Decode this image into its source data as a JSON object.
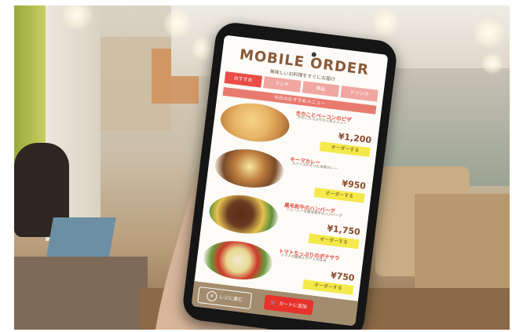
{
  "photo": {
    "subject": "hand holding smartphone with mobile order app in restaurant"
  },
  "app": {
    "title": "MOBILE ORDER",
    "subtitle": "美味しいお料理をすぐにお届け",
    "tabs": [
      {
        "label": "おすすめ",
        "active": true
      },
      {
        "label": "ランチ",
        "active": false
      },
      {
        "label": "単品",
        "active": false
      },
      {
        "label": "ドリンク",
        "active": false
      }
    ],
    "section_label": "今日のおすすめメニュー",
    "items": [
      {
        "name": "きのことベーコンのピザ",
        "description": "きのこたっぷりの人気メニュー",
        "price": "¥1,200",
        "order_label": "オーダーする"
      },
      {
        "name": "キーマカレー",
        "description": "スパイスのきいた本格カレー",
        "price": "¥950",
        "order_label": "オーダーする"
      },
      {
        "name": "黒毛和牛のハンバーグ",
        "description": "ジューシーな黒毛和牛のハンバーグ",
        "price": "¥1,750",
        "order_label": "オーダーする"
      },
      {
        "name": "トマトたっぷりのポテサラ",
        "description": "トマトの酸味とポテトの甘み",
        "price": "¥750",
        "order_label": "オーダーする"
      }
    ],
    "bottom": {
      "register_label": "レジに進む",
      "cart_label": "カートに追加"
    }
  },
  "colors": {
    "accent_red": "#e8322c",
    "tab_active": "#e84d46",
    "order_yellow": "#f4e94a",
    "title_brown": "#8a5a3a",
    "bottom_bar": "#a38c6e"
  }
}
